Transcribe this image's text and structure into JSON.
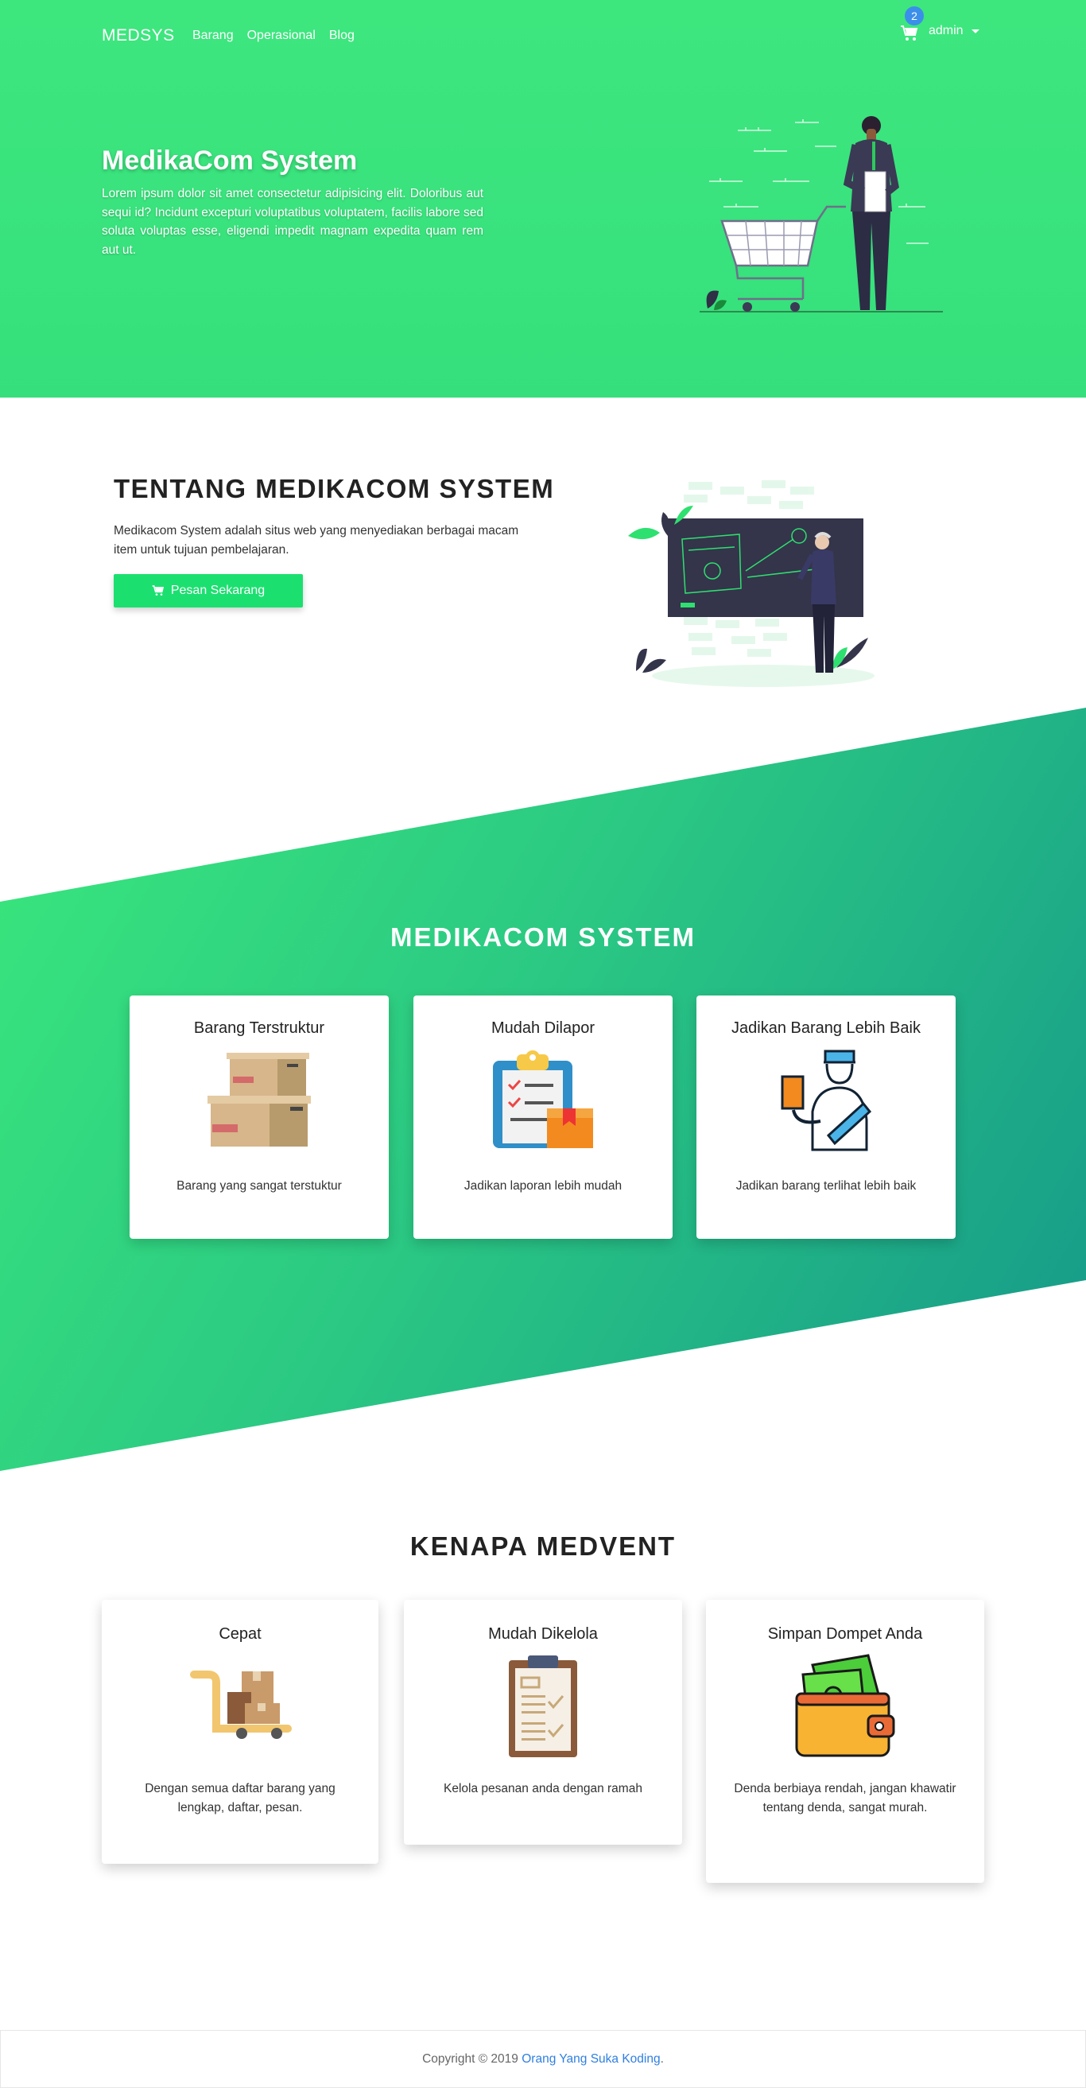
{
  "navbar": {
    "brand": "MEDSYS",
    "links": [
      "Barang",
      "Operasional",
      "Blog"
    ],
    "cart_count": "2",
    "user": "admin"
  },
  "hero": {
    "title": "MedikaCom System",
    "text": "Lorem ipsum dolor sit amet consectetur adipisicing elit. Doloribus aut sequi id? Incidunt excepturi voluptatibus voluptatem, facilis labore sed soluta voluptas esse, eligendi impedit magnam expedita quam rem aut ut."
  },
  "about": {
    "title": "TENTANG MEDIKACOM SYSTEM",
    "text": "Medikacom System adalah situs web yang menyediakan berbagai macam item untuk tujuan pembelajaran.",
    "button": "Pesan Sekarang"
  },
  "features": {
    "title": "MEDIKACOM SYSTEM",
    "cards": [
      {
        "title": "Barang Terstruktur",
        "text": "Barang yang sangat terstuktur",
        "icon": "boxes-icon"
      },
      {
        "title": "Mudah Dilapor",
        "text": "Jadikan laporan lebih mudah",
        "icon": "clipboard-checklist-icon"
      },
      {
        "title": "Jadikan Barang Lebih Baik",
        "text": "Jadikan barang terlihat lebih baik",
        "icon": "courier-icon"
      }
    ]
  },
  "why": {
    "title": "KENAPA MEDVENT",
    "cards": [
      {
        "title": "Cepat",
        "text": "Dengan semua daftar barang yang lengkap, daftar, pesan.",
        "icon": "hand-truck-icon"
      },
      {
        "title": "Mudah Dikelola",
        "text": "Kelola pesanan anda dengan ramah",
        "icon": "clipboard-icon"
      },
      {
        "title": "Simpan Dompet Anda",
        "text": "Denda berbiaya rendah, jangan khawatir tentang denda, sangat murah.",
        "icon": "wallet-icon"
      }
    ]
  },
  "footer": {
    "copyright": "Copyright © 2019",
    "link": "Orang Yang Suka Koding",
    "suffix": "."
  },
  "colors": {
    "primary_green": "#3ee67e",
    "button_green": "#1be070",
    "teal": "#15988a",
    "link_blue": "#2f7fe0",
    "badge_blue": "#3b8fea"
  }
}
